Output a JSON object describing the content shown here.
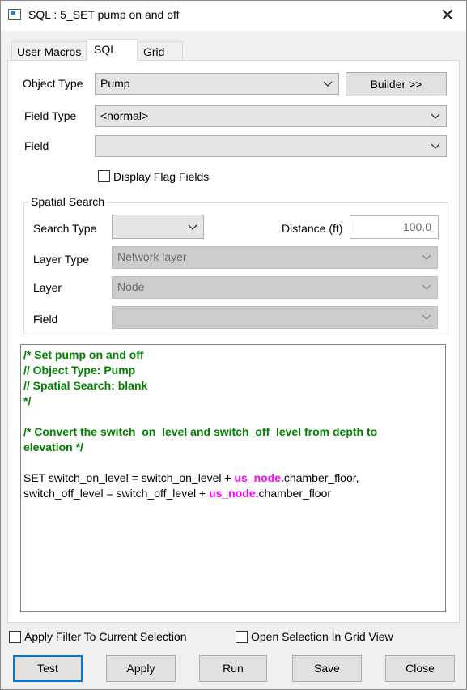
{
  "window": {
    "title": "SQL : 5_SET pump on and off",
    "close_symbol": "✕"
  },
  "tabs": [
    "User Macros",
    "SQL",
    "Grid"
  ],
  "active_tab": "SQL",
  "form": {
    "object_type_label": "Object Type",
    "object_type_value": "Pump",
    "builder_label": "Builder >>",
    "field_type_label": "Field Type",
    "field_type_value": "<normal>",
    "field_label": "Field",
    "field_value": "",
    "display_flag_fields_label": "Display Flag Fields",
    "display_flag_fields_checked": false
  },
  "spatial_search": {
    "title": "Spatial Search",
    "search_type_label": "Search Type",
    "search_type_value": "",
    "distance_label": "Distance (ft)",
    "distance_value": "100.0",
    "layer_type_label": "Layer Type",
    "layer_type_value": "Network layer",
    "layer_label": "Layer",
    "layer_value": "Node",
    "field_label": "Field",
    "field_value": ""
  },
  "editor": {
    "comment_lines": [
      "/* Set pump on and off",
      "// Object Type: Pump",
      "// Spatial Search: blank",
      "*/",
      "/*  Convert the switch_on_level and switch_off_level from depth to",
      "elevation */"
    ],
    "code_line1_a": "SET switch_on_level = switch_on_level + ",
    "code_line1_kw": "us_node.",
    "code_line1_b": "chamber_floor,",
    "code_line2_a": "switch_off_level = switch_off_level + ",
    "code_line2_kw": "us_node.",
    "code_line2_b": "chamber_floor"
  },
  "options": {
    "apply_filter_label": "Apply Filter To Current Selection",
    "apply_filter_checked": false,
    "open_selection_label": "Open Selection In Grid View",
    "open_selection_checked": false
  },
  "buttons": {
    "test": "Test",
    "apply": "Apply",
    "run": "Run",
    "save": "Save",
    "close": "Close"
  },
  "colors": {
    "comment": "#008000",
    "keyword": "#ff00ff",
    "default_button_border": "#0078d7"
  }
}
